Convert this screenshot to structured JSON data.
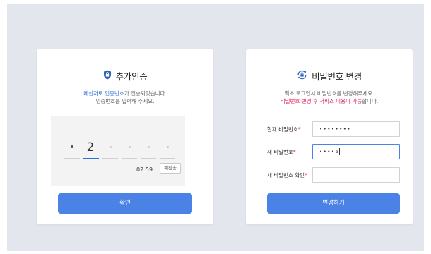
{
  "verify": {
    "title": "추가인증",
    "desc_line1_highlight": "메신저로 인증번호",
    "desc_line1_rest": "가 전송되었습니다.",
    "desc_line2": "인증번호를 입력해 주세요.",
    "otp_digit": "2",
    "timer": "02:59",
    "resend_label": "재전송",
    "confirm_label": "확인"
  },
  "password": {
    "title": "비밀번호 변경",
    "desc_line1": "최초 로그인시 비밀번호를 변경해주세요.",
    "desc_line2_red": "비밀번호 변경 후 서비스 이용이 가능",
    "desc_line2_rest": "합니다.",
    "fields": [
      {
        "label": "현재 비밀번호",
        "value": "••••••••"
      },
      {
        "label": "새 비밀번호",
        "value": "••••5"
      },
      {
        "label": "새 비밀번호 확인",
        "value": ""
      }
    ],
    "required_mark": "*",
    "submit_label": "변경하기"
  },
  "colors": {
    "accent": "#4a82e6",
    "highlight_blue": "#2d6fd6",
    "highlight_red": "#e0285a",
    "background": "#e3e6ed"
  },
  "icons": {
    "verify": "shield-lock-icon",
    "password": "lock-refresh-icon"
  }
}
